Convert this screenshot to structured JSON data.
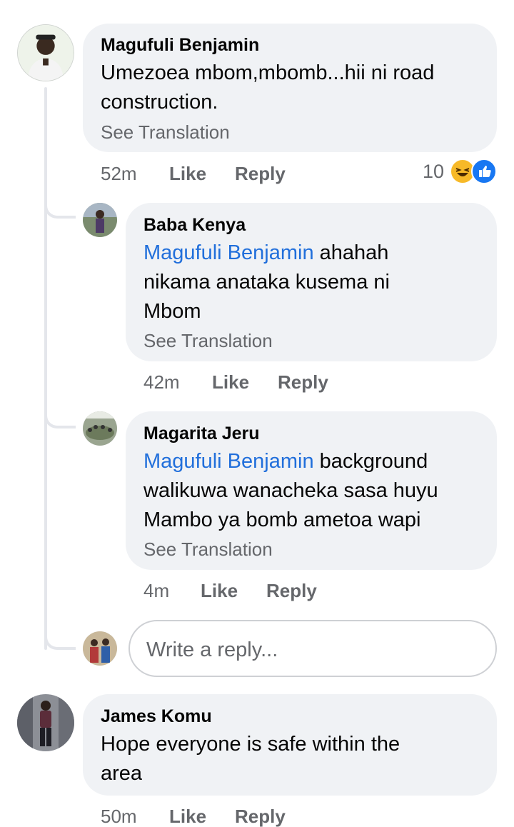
{
  "comments": [
    {
      "author": "Magufuli Benjamin",
      "text_line1": "Umezoea mbom,mbomb...hii ni road",
      "text_line2": "construction.",
      "see_translation": "See Translation",
      "time": "52m",
      "like": "Like",
      "reply": "Reply",
      "reaction_count": "10",
      "reaction_icons": [
        "haha-icon",
        "like-icon"
      ],
      "replies": [
        {
          "author": "Baba Kenya",
          "mention": "Magufuli Benjamin",
          "text_line1_rest": " ahahah",
          "text_line2": "nikama anataka kusema ni",
          "text_line3": "Mbom",
          "see_translation": "See Translation",
          "time": "42m",
          "like": "Like",
          "reply": "Reply"
        },
        {
          "author": "Magarita Jeru",
          "mention": "Magufuli Benjamin",
          "text_line1_rest": " background",
          "text_line2": "walikuwa wanacheka sasa huyu",
          "text_line3": "Mambo ya bomb ametoa wapi",
          "see_translation": "See Translation",
          "time": "4m",
          "like": "Like",
          "reply": "Reply"
        }
      ],
      "reply_input_placeholder": "Write a reply..."
    },
    {
      "author": "James Komu",
      "text_line1": "Hope everyone is safe within the",
      "text_line2": "area",
      "time": "50m",
      "like": "Like",
      "reply": "Reply"
    }
  ],
  "colors": {
    "bubble": "#f0f2f5",
    "mention": "#216fdb",
    "meta": "#65676b",
    "like_blue": "#1877f2",
    "haha_yellow": "#f7b928"
  }
}
